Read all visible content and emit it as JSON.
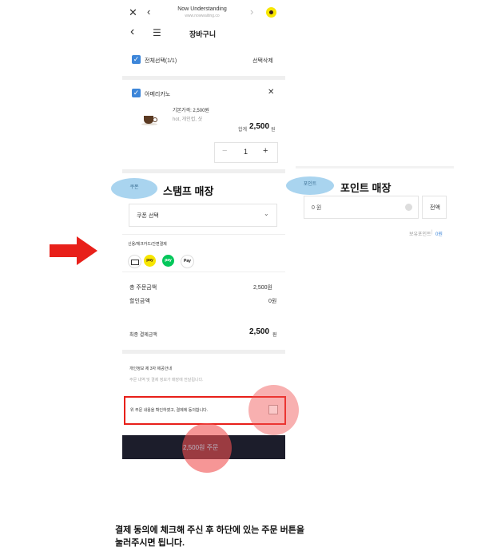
{
  "browser": {
    "site_title": "Now Understanding",
    "site_url": "www.nowwaiting.co"
  },
  "header": {
    "title": "장바구니"
  },
  "select_bar": {
    "select_all": "전체선택(1/1)",
    "delete_selected": "선택삭제"
  },
  "product": {
    "name": "아메리카노",
    "base_price": "기본가격: 2,500원",
    "options": "hot, 개인컵, 샷",
    "total_label": "합계",
    "total_value": "2,500",
    "total_unit": "원",
    "quantity": "1",
    "minus": "−",
    "plus": "+"
  },
  "coupon": {
    "badge": "쿠폰",
    "heading": "스탬프 매장",
    "select_label": "쿠폰 선택"
  },
  "point": {
    "badge": "포인트",
    "heading": "포인트 매장",
    "input_value": "0 원",
    "all_button": "전액",
    "owned_label": "보유포인트",
    "owned_value": "0원"
  },
  "payment": {
    "method_label": "신용/체크카드/간편결제",
    "methods": [
      "card",
      "pay",
      "pay",
      "Pay"
    ]
  },
  "summary": {
    "total_order_label": "총 주문금액",
    "total_order_value": "2,500원",
    "discount_label": "할인금액",
    "discount_value": "0원",
    "final_label": "최종 결제금액",
    "final_value": "2,500",
    "final_unit": "원"
  },
  "privacy": {
    "title": "개인정보 제 3자 제공안내",
    "desc": "주문 내역 및 결제 정보가 매장에 전달됩니다."
  },
  "agree": {
    "text": "위 주문 내용을 확인하였고, 결제에 동의합니다."
  },
  "order_button": {
    "label": "2,500원 주문"
  },
  "caption": {
    "line1": "결제 동의에 체크해 주신 후 하단에 있는 주문 버튼을",
    "line2": "눌러주시면 됩니다."
  },
  "colors": {
    "accent_blue": "#3d86d9",
    "highlight_red": "#e8201a",
    "button_dark": "#1c1d2b",
    "ellipse_blue": "#a9d4ef"
  }
}
